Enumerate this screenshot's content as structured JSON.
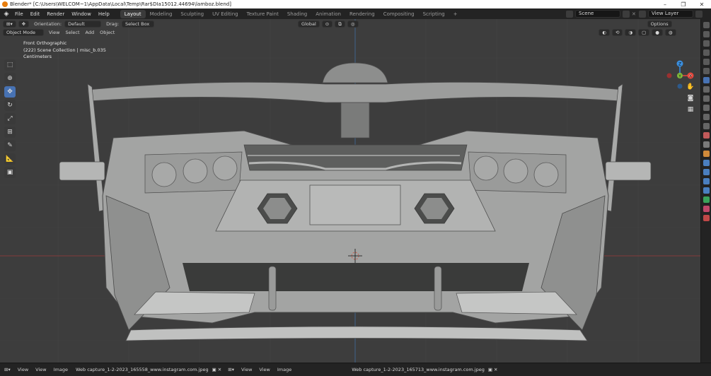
{
  "window": {
    "title": "Blender* [C:\\Users\\WELCOM~1\\AppData\\Local\\Temp\\Rar$DIa15012.44694\\lamboz.blend]",
    "controls": [
      "–",
      "❐",
      "✕"
    ]
  },
  "menu": {
    "items": [
      "File",
      "Edit",
      "Render",
      "Window",
      "Help"
    ]
  },
  "workspaces": {
    "tabs": [
      "Layout",
      "Modeling",
      "Sculpting",
      "UV Editing",
      "Texture Paint",
      "Shading",
      "Animation",
      "Rendering",
      "Compositing",
      "Scripting"
    ],
    "active": "Layout",
    "add": "+"
  },
  "scene": {
    "label": "Scene"
  },
  "view_layer": {
    "label": "View Layer"
  },
  "viewport_header": {
    "orientation_label": "Orientation:",
    "orientation_value": "Default",
    "drag_label": "Drag:",
    "drag_value": "Select Box",
    "transform_orientation": "Global",
    "options": "Options"
  },
  "viewport_header2": {
    "mode": "Object Mode",
    "menus": [
      "View",
      "Select",
      "Add",
      "Object"
    ]
  },
  "viewport_info": {
    "line1": "Front Orthographic",
    "line2": "(222) Scene Collection | misc_b.035",
    "line3": "Centimeters"
  },
  "gizmo": {
    "axes": [
      "Z",
      "X",
      "Y"
    ],
    "colors": {
      "x": "#e8483d",
      "y": "#7fb83a",
      "z": "#3a8fe0"
    }
  },
  "bottom_bar": {
    "left_menus": [
      "View",
      "View",
      "Image"
    ],
    "image1": "Web capture_1-2-2023_165558_www.instagram.com.jpeg",
    "right_menus": [
      "View",
      "View",
      "Image"
    ],
    "image2": "Web capture_1-2-2023_165713_www.instagram.com.jpeg"
  },
  "colors": {
    "viewport_bg": "#3d3d3d",
    "active_blue": "#4772b3",
    "axis_red": "#b43c3c",
    "axis_blue": "#3c6fa8"
  }
}
